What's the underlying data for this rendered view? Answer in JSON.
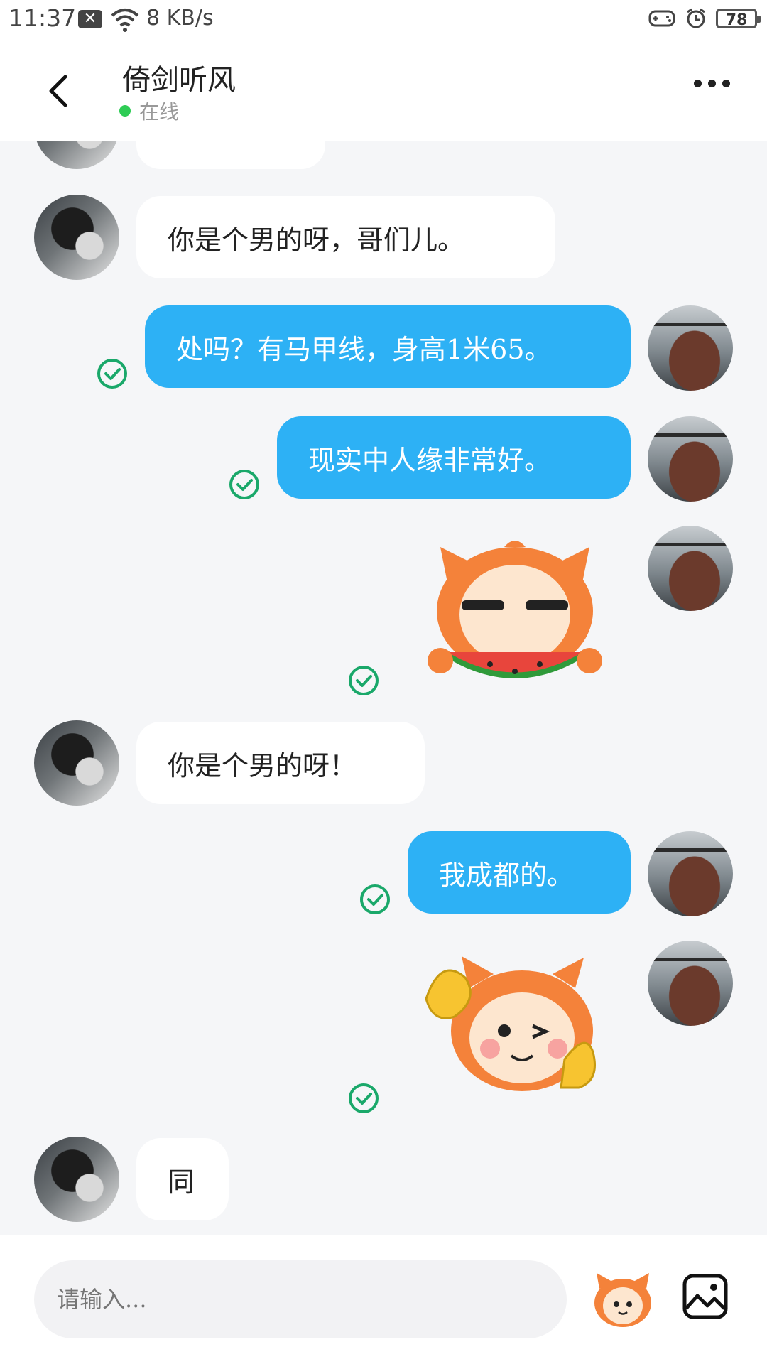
{
  "status_bar": {
    "time": "11:37",
    "speed": "8 KB/s",
    "battery": "78"
  },
  "header": {
    "title": "倚剑听风",
    "status": "在线"
  },
  "messages": [
    {
      "from": "other",
      "text": ""
    },
    {
      "from": "other",
      "text": "你是个男的呀，哥们儿。"
    },
    {
      "from": "self",
      "text": "处吗？有马甲线，身高1米65。",
      "read": true
    },
    {
      "from": "self",
      "text": "现实中人缘非常好。",
      "read": true
    },
    {
      "from": "self",
      "sticker": "watermelon-sticker",
      "read": true
    },
    {
      "from": "other",
      "text": "你是个男的呀！"
    },
    {
      "from": "self",
      "text": "我成都的。",
      "read": true
    },
    {
      "from": "self",
      "sticker": "wink-thumbs-up-sticker",
      "read": true
    },
    {
      "from": "other",
      "text": "同"
    }
  ],
  "input": {
    "placeholder": "请输入..."
  },
  "colors": {
    "outgoing_bubble": "#2db1f5",
    "incoming_bubble": "#ffffff",
    "read_check": "#1aa86a",
    "online": "#2ecc55"
  }
}
